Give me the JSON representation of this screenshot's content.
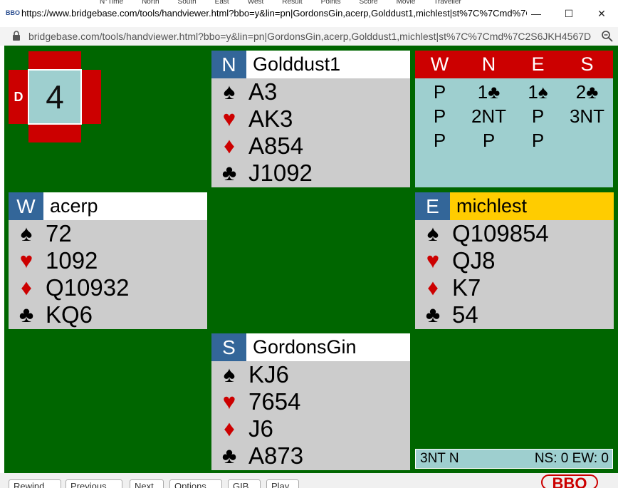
{
  "window": {
    "favicon_text": "BBO",
    "title": "https://www.bridgebase.com/tools/handviewer.html?bbo=y&lin=pn|GordonsGin,acerp,Golddust1,michlest|st%7C%7Cmd%7C2S6JK...",
    "background_headers": [
      "N°Time",
      "North",
      "South",
      "East",
      "West",
      "Result",
      "Points",
      "Score",
      "Movie",
      "Traveller"
    ],
    "minimize_glyph": "—",
    "maximize_glyph": "☐",
    "close_glyph": "✕"
  },
  "address_bar": {
    "url": "bridgebase.com/tools/handviewer.html?bbo=y&lin=pn|GordonsGin,acerp,Golddust1,michlest|st%7C%7Cmd%7C2S6JKH4567D..."
  },
  "board": {
    "number": "4",
    "dealer_label": "D"
  },
  "hands": {
    "north": {
      "seat": "N",
      "player": "Golddust1",
      "spades": "A3",
      "hearts": "AK3",
      "diamonds": "A854",
      "clubs": "J1092"
    },
    "west": {
      "seat": "W",
      "player": "acerp",
      "spades": "72",
      "hearts": "1092",
      "diamonds": "Q10932",
      "clubs": "KQ6"
    },
    "east": {
      "seat": "E",
      "player": "michlest",
      "spades": "Q109854",
      "hearts": "QJ8",
      "diamonds": "K7",
      "clubs": "54"
    },
    "south": {
      "seat": "S",
      "player": "GordonsGin",
      "spades": "KJ6",
      "hearts": "7654",
      "diamonds": "J6",
      "clubs": "A873"
    }
  },
  "suits": {
    "spade": "♠",
    "heart": "♥",
    "diamond": "♦",
    "club": "♣"
  },
  "auction": {
    "headers": [
      "W",
      "N",
      "E",
      "S"
    ],
    "rows": [
      [
        "P",
        "1♣",
        "1♠",
        "2♣"
      ],
      [
        "P",
        "2NT",
        "P",
        "3NT"
      ],
      [
        "P",
        "P",
        "P",
        ""
      ]
    ]
  },
  "status": {
    "contract": "3NT N",
    "score": "NS: 0 EW: 0"
  },
  "bottom_buttons": [
    "Rewind",
    "Previous",
    "Next",
    "Options",
    "GIB",
    "Play"
  ],
  "logo_text": "BBO",
  "colors": {
    "table_green": "#006600",
    "seat_blue": "#336699",
    "auction_red": "#cc0000",
    "panel_teal": "#9ecfcf",
    "turn_yellow": "#ffcc00",
    "heart_red": "#cc0000"
  }
}
